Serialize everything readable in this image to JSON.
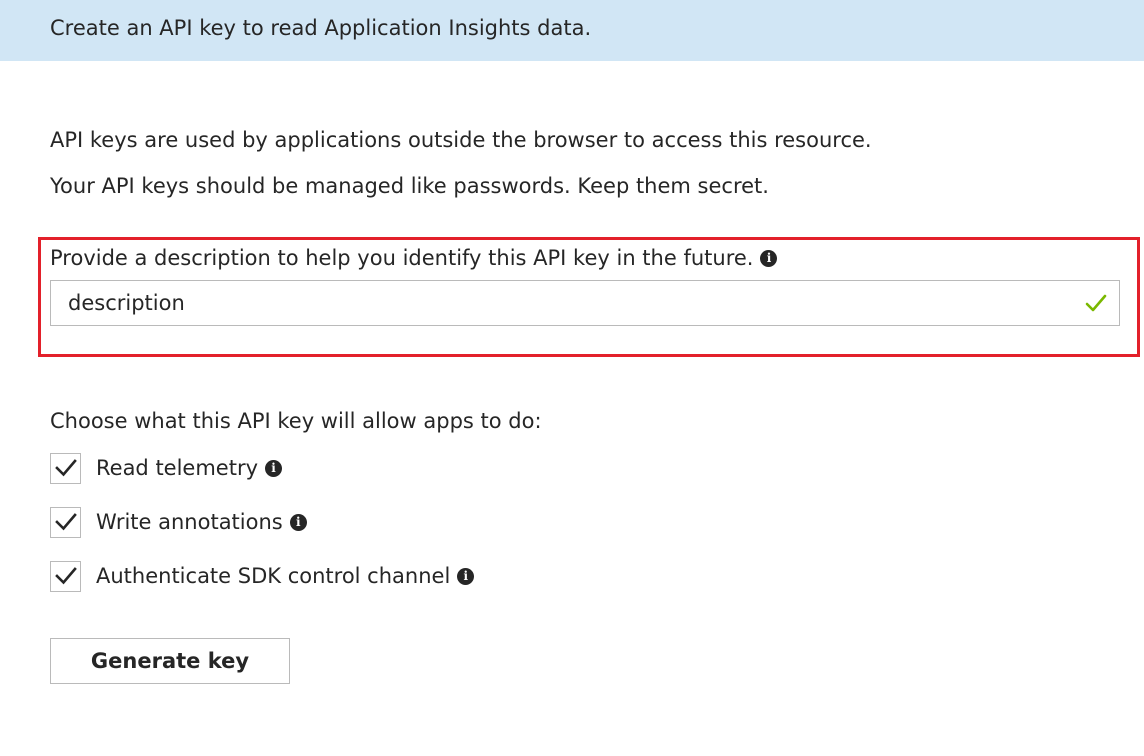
{
  "banner": {
    "text": "Create an API key to read Application Insights data."
  },
  "intro": {
    "line1": "API keys are used by applications outside the browser to access this resource.",
    "line2": "Your API keys should be managed like passwords. Keep them secret."
  },
  "description": {
    "label": "Provide a description to help you identify this API key in the future.",
    "value": "description",
    "valid": true,
    "highlight_color": "#e3202a"
  },
  "permissions": {
    "heading": "Choose what this API key will allow apps to do:",
    "items": [
      {
        "label": "Read telemetry",
        "checked": true
      },
      {
        "label": "Write annotations",
        "checked": true
      },
      {
        "label": "Authenticate SDK control channel",
        "checked": true
      }
    ]
  },
  "actions": {
    "generate_label": "Generate key"
  },
  "colors": {
    "banner_bg": "#d1e6f5",
    "valid_check": "#7ab800",
    "text": "#262626"
  }
}
